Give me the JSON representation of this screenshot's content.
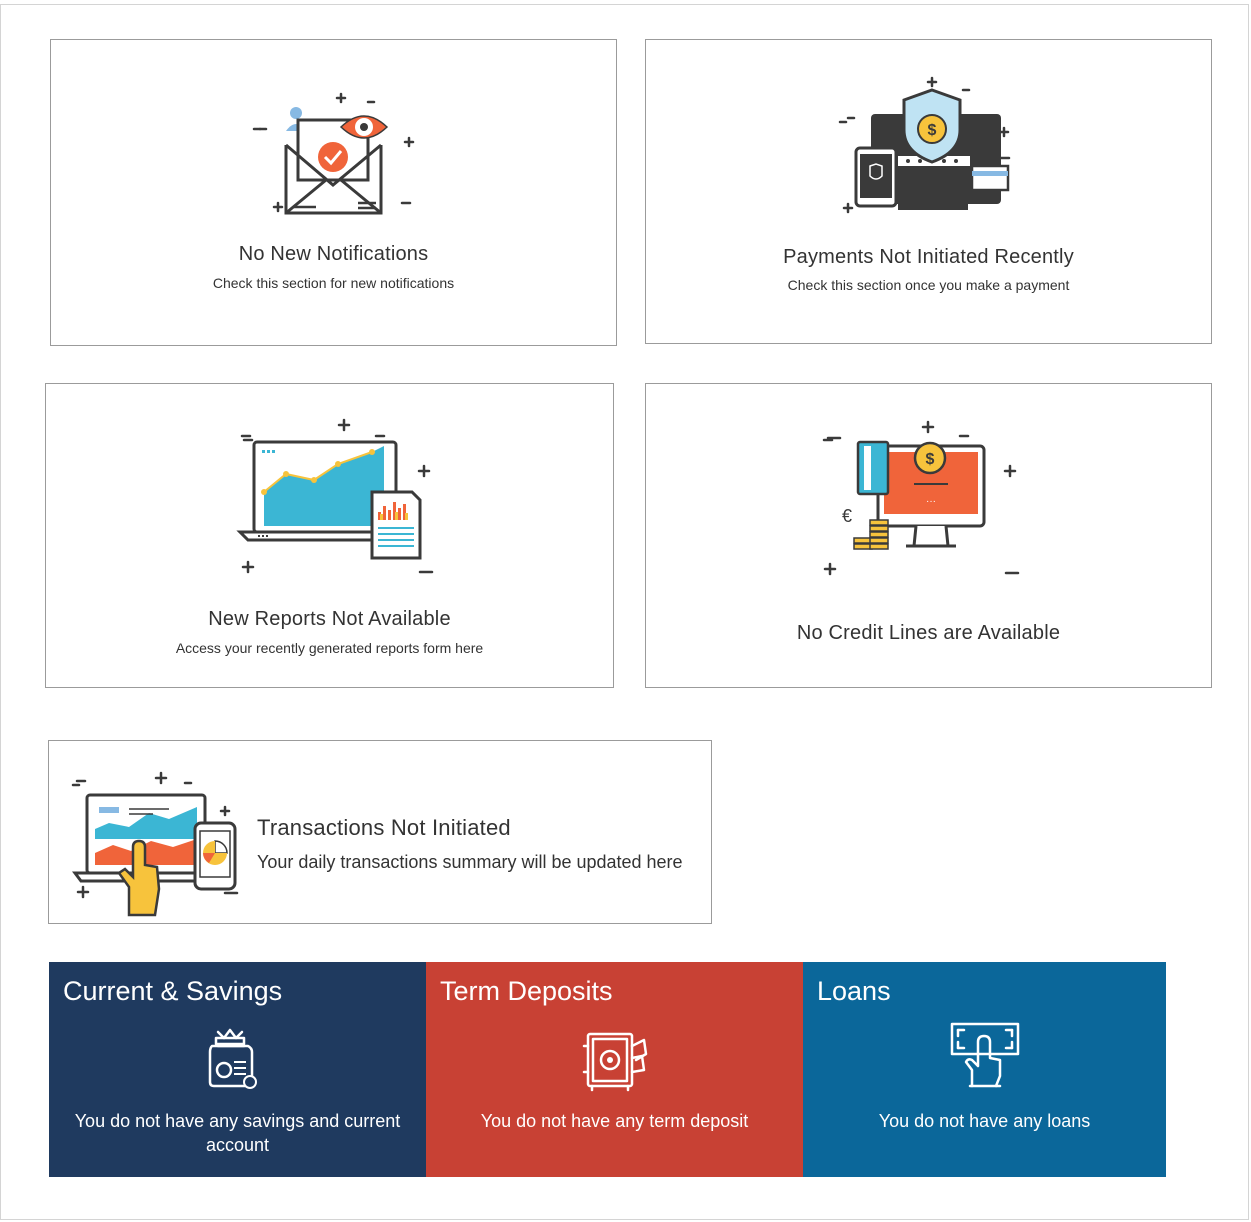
{
  "cards": {
    "notifications": {
      "title": "No New Notifications",
      "subtitle": "Check this section for new notifications",
      "icon": "mail-eye-icon"
    },
    "payments": {
      "title": "Payments Not Initiated Recently",
      "subtitle": "Check this section once you make a payment",
      "icon": "secure-payment-devices-icon"
    },
    "reports": {
      "title": "New Reports Not Available",
      "subtitle": "Access your recently generated reports form here",
      "icon": "laptop-chart-report-icon"
    },
    "credit_lines": {
      "title": "No Credit Lines are  Available",
      "icon": "monitor-credit-card-coins-icon",
      "currency_symbol": "€"
    },
    "transactions": {
      "title": "Transactions  Not Initiated",
      "subtitle": "Your daily transactions summary will be updated here",
      "icon": "laptop-hand-phone-icon"
    }
  },
  "tiles": {
    "current_savings": {
      "title": "Current & Savings",
      "message": "You do not have any savings and current account",
      "color": "#1f3a5f",
      "icon": "savings-jar-icon"
    },
    "term_deposits": {
      "title": "Term Deposits",
      "message": "You do not have any term deposit",
      "color": "#c84134",
      "icon": "safe-icon"
    },
    "loans": {
      "title": "Loans",
      "message": "You do not have any loans",
      "color": "#0b679a",
      "icon": "hand-money-icon"
    }
  },
  "colors": {
    "accent_orange": "#f0643a",
    "accent_blue": "#3bb6d4",
    "accent_yellow": "#f7c33c",
    "outline": "#3a3a3a"
  }
}
